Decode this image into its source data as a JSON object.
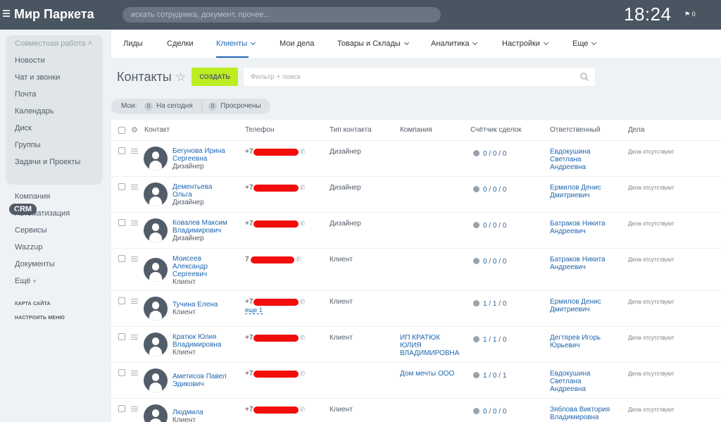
{
  "header": {
    "app_title": "Мир Паркета",
    "search_placeholder": "искать сотрудника, документ, прочее...",
    "clock": "18:24",
    "notifications": "0"
  },
  "sidebar": {
    "group_title": "Совместная работа",
    "group_items": [
      "Новости",
      "Чат и звонки",
      "Почта",
      "Календарь",
      "Диск",
      "Группы"
    ],
    "items": [
      "Задачи и Проекты",
      "CRM",
      "Компания",
      "Автоматизация",
      "Сервисы",
      "Wazzup",
      "Документы",
      "Ещё"
    ],
    "site_map": "КАРТА САЙТА",
    "configure_menu": "НАСТРОИТЬ МЕНЮ"
  },
  "tabs": [
    {
      "label": "Лиды"
    },
    {
      "label": "Сделки"
    },
    {
      "label": "Клиенты"
    },
    {
      "label": "Мои дела"
    },
    {
      "label": "Товары и Склады"
    },
    {
      "label": "Аналитика"
    },
    {
      "label": "Настройки"
    },
    {
      "label": "Еще"
    }
  ],
  "page": {
    "title": "Контакты",
    "create_label": "СОЗДАТЬ",
    "filter_placeholder": "Фильтр + поиск"
  },
  "counters": {
    "label": "Мои:",
    "today_count": "0",
    "today_label": "На сегодня",
    "overdue_count": "0",
    "overdue_label": "Просрочены"
  },
  "table": {
    "columns": [
      "Контакт",
      "Телефон",
      "Тип контакта",
      "Компания",
      "Счётчик сделок",
      "Ответственный",
      "Дела"
    ],
    "rows": [
      {
        "name": "Бегунова Ирина Сергеевна",
        "type": "Дизайнер",
        "phone": "+7",
        "contact_type": "Дизайнер",
        "company": "",
        "deals": [
          "0",
          "0",
          "0"
        ],
        "responsible": "Евдокушина Светлана Андреевна",
        "activities": "Дела отсутствуют"
      },
      {
        "name": "Дементьева Ольга",
        "type": "Дизайнер",
        "phone": "+7",
        "contact_type": "Дизайнер",
        "company": "",
        "deals": [
          "0",
          "0",
          "0"
        ],
        "responsible": "Ермилов Денис Дмитриевич",
        "activities": "Дела отсутствуют"
      },
      {
        "name": "Ковалев Максим Владимирович",
        "type": "Дизайнер",
        "phone": "+7",
        "contact_type": "Дизайнер",
        "company": "",
        "deals": [
          "0",
          "0",
          "0"
        ],
        "responsible": "Батраков Никита Андреевич",
        "activities": "Дела отсутствуют"
      },
      {
        "name": "Моисеев Александр Сергеевич",
        "type": "Клиент",
        "phone": "7",
        "contact_type": "Клиент",
        "company": "",
        "deals": [
          "0",
          "0",
          "0"
        ],
        "responsible": "Батраков Никита Андреевич",
        "activities": "Дела отсутствуют"
      },
      {
        "name": "Тучина Елена",
        "type": "Клиент",
        "phone": "+7",
        "phone_more": "еще 1",
        "contact_type": "Клиент",
        "company": "",
        "deals": [
          "1",
          "1",
          "0"
        ],
        "responsible": "Ермилов Денис Дмитриевич",
        "activities": "Дела отсутствуют"
      },
      {
        "name": "Кратюк Юлия Владимировна",
        "type": "Клиент",
        "phone": "+7",
        "contact_type": "Клиент",
        "company": "ИП КРАТЮК ЮЛИЯ ВЛАДИМИРОВНА",
        "deals": [
          "1",
          "1",
          "0"
        ],
        "responsible": "Дегтярев Игорь Юрьевич",
        "activities": "Дела отсутствуют"
      },
      {
        "name": "Аметисов Павел Эдикович",
        "type": "",
        "phone": "+7",
        "contact_type": "",
        "company": "Дом мечты ООО",
        "deals": [
          "1",
          "0",
          "1"
        ],
        "responsible": "Евдокушина Светлана Андреевна",
        "activities": "Дела отсутствуют"
      },
      {
        "name": "Людмила",
        "type": "Клиент",
        "phone": "+7",
        "contact_type": "Клиент",
        "company": "",
        "deals": [
          "0",
          "0",
          "0"
        ],
        "responsible": "Зяблова Виктория Владимировна",
        "activities": "Дела отсутствуют"
      }
    ]
  },
  "colors": {
    "topbar": "#4a5562",
    "accent_link": "#2067b0",
    "create_button": "#bbed21",
    "redaction": "#f20d0d"
  },
  "icons": {
    "favorite": "star-icon",
    "filter": "search-icon",
    "settings": "gear-icon",
    "phone": "call-icon",
    "avatar": "user-silhouette-icon"
  }
}
